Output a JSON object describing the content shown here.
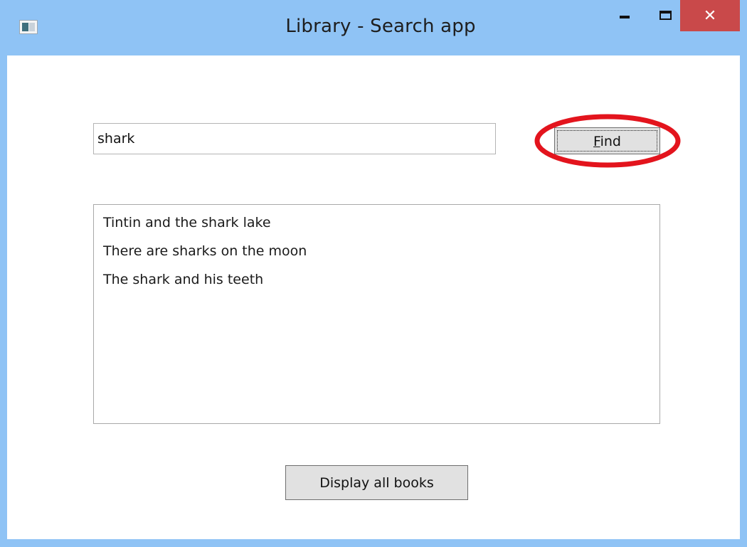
{
  "window": {
    "title": "Library - Search app",
    "controls": {
      "close_glyph": "✕"
    }
  },
  "search": {
    "value": "shark",
    "find_label_mnemonic": "F",
    "find_label_rest": "ind"
  },
  "results": {
    "items": [
      {
        "label": "Tintin and the shark lake"
      },
      {
        "label": "There are sharks on the moon"
      },
      {
        "label": "The shark and his teeth"
      }
    ]
  },
  "footer": {
    "display_all_label": "Display all books"
  },
  "colors": {
    "titlebar": "#8fc3f5",
    "close_button": "#c9494a",
    "annotation": "#e3141d",
    "button_face": "#e1e1e1"
  },
  "icons": {
    "app": "window-app-icon",
    "minimize": "minimize-icon",
    "maximize": "maximize-icon",
    "close": "close-icon"
  }
}
